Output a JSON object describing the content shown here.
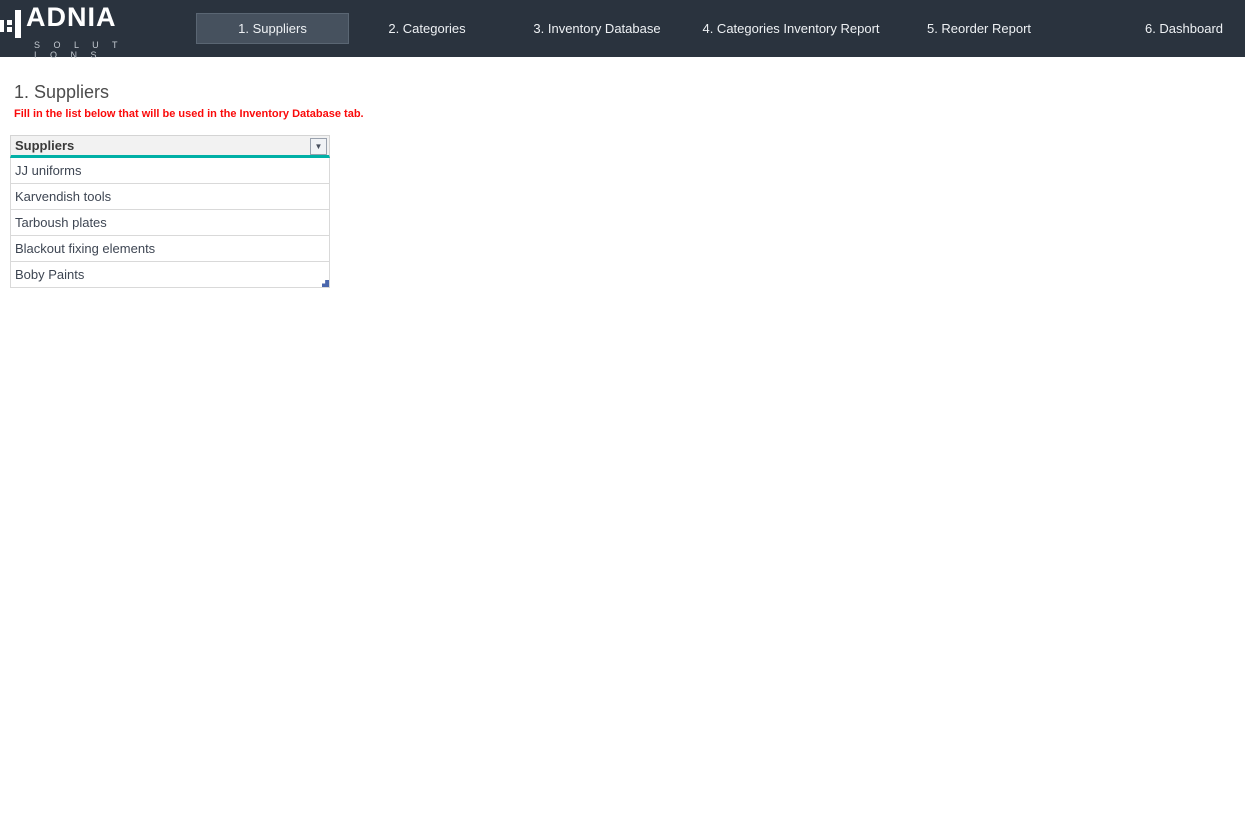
{
  "brand": {
    "name": "ADNIA",
    "subtitle": "S O L U T I O N S"
  },
  "nav": {
    "tabs": [
      {
        "label": "1. Suppliers",
        "active": true
      },
      {
        "label": "2. Categories",
        "active": false
      },
      {
        "label": "3. Inventory Database",
        "active": false
      },
      {
        "label": "4. Categories Inventory Report",
        "active": false
      },
      {
        "label": "5. Reorder Report",
        "active": false
      },
      {
        "label": "6. Dashboard",
        "active": false
      }
    ]
  },
  "page": {
    "title": "1. Suppliers",
    "note": "Fill in the list below that will be used in the Inventory Database tab."
  },
  "table": {
    "header": "Suppliers",
    "rows": [
      "JJ uniforms",
      "Karvendish tools",
      "Tarboush plates",
      "Blackout fixing elements",
      "Boby Paints"
    ]
  },
  "icons": {
    "filter_dropdown_glyph": "▼"
  },
  "colors": {
    "navbar_bg": "#2a333e",
    "active_tab_bg": "#46515e",
    "accent_teal": "#00b0a6",
    "note_red": "#fa0a0a",
    "resize_handle_blue": "#4a66ac",
    "row_border": "#d9d9d9"
  }
}
